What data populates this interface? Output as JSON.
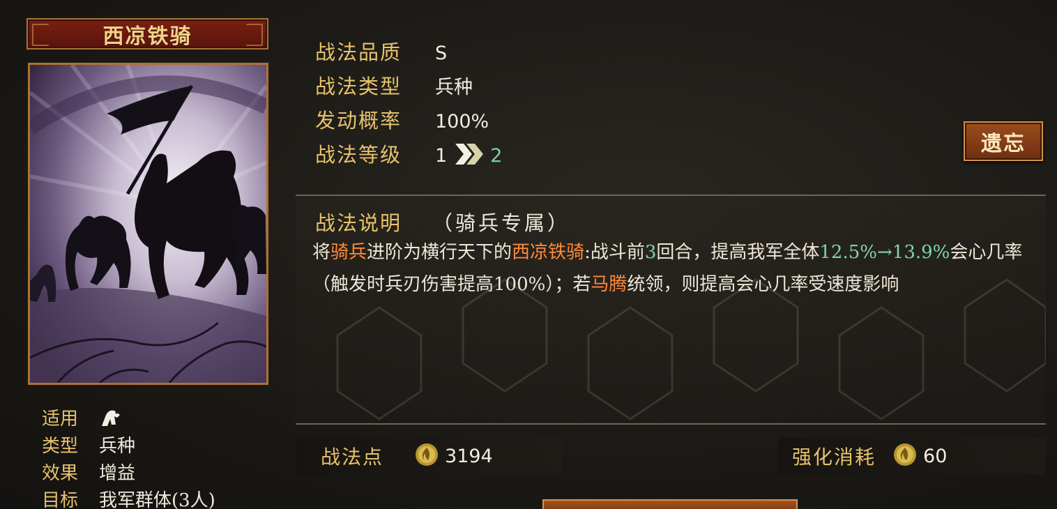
{
  "skill": {
    "name": "西凉铁骑"
  },
  "info": {
    "apply_label": "适用",
    "apply_icon": "cavalry-horse-icon",
    "type_label": "类型",
    "type_value": "兵种",
    "effect_label": "效果",
    "effect_value": "增益",
    "target_label": "目标",
    "target_value": "我军群体(3人)"
  },
  "attributes": {
    "quality_label": "战法品质",
    "quality_value": "S",
    "kind_label": "战法类型",
    "kind_value": "兵种",
    "rate_label": "发动概率",
    "rate_value": "100%",
    "level_label": "战法等级",
    "level_current": "1",
    "level_next": "2"
  },
  "forget_button": "遗忘",
  "description": {
    "label": "战法说明",
    "tag": "（骑兵专属）",
    "segments": [
      {
        "text": "将",
        "style": "normal"
      },
      {
        "text": "骑兵",
        "style": "orange"
      },
      {
        "text": "进阶为横行天下的",
        "style": "normal"
      },
      {
        "text": "西凉铁骑",
        "style": "orange"
      },
      {
        "text": ":战斗前",
        "style": "normal"
      },
      {
        "text": "3",
        "style": "green"
      },
      {
        "text": "回合，提高我军全体",
        "style": "normal"
      },
      {
        "text": "12.5%→13.9%",
        "style": "green"
      },
      {
        "text": "会心几率（触发时兵刃伤害提高100%）；若",
        "style": "normal"
      },
      {
        "text": "马腾",
        "style": "orange"
      },
      {
        "text": "统领，则提高会心几率受速度影响",
        "style": "normal"
      }
    ]
  },
  "points": {
    "label": "战法点",
    "value": "3194",
    "icon": "tactic-point-coin-icon"
  },
  "cost": {
    "label": "强化消耗",
    "value": "60",
    "icon": "tactic-point-coin-icon"
  },
  "colors": {
    "gold_label": "#e7c26a",
    "highlight_orange": "#ff8a3a",
    "highlight_green": "#7fd4a8",
    "title_plate": "#6a1a0e"
  }
}
